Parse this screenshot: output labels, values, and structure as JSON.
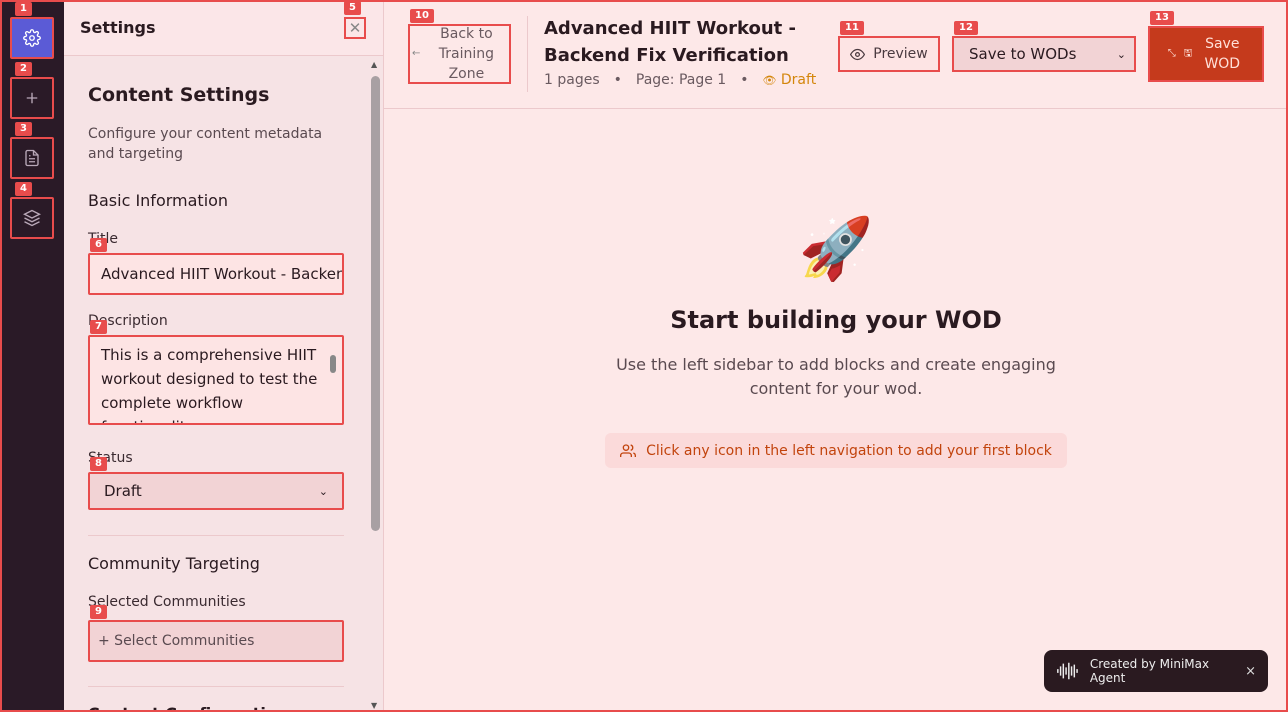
{
  "rail": {
    "items": [
      {
        "name": "settings",
        "marker": "1"
      },
      {
        "name": "add",
        "marker": "2"
      },
      {
        "name": "pages",
        "marker": "3"
      },
      {
        "name": "layers",
        "marker": "4"
      }
    ]
  },
  "panel": {
    "header_title": "Settings",
    "close_marker": "5",
    "section_title": "Content Settings",
    "section_desc": "Configure your content metadata and targeting",
    "basic_info_title": "Basic Information",
    "title_label": "Title",
    "title_value": "Advanced HIIT Workout - Backend Fix Verification",
    "title_marker": "6",
    "description_label": "Description",
    "description_value": "This is a comprehensive HIIT workout designed to test the complete workflow functionality",
    "description_marker": "7",
    "status_label": "Status",
    "status_value": "Draft",
    "status_marker": "8",
    "community_title": "Community Targeting",
    "communities_label": "Selected Communities",
    "communities_button": "+ Select Communities",
    "communities_marker": "9",
    "next_section_title": "Content Configuration"
  },
  "header": {
    "back_label": "Back to Training Zone",
    "back_marker": "10",
    "title": "Advanced HIIT Workout - Backend Fix Verification",
    "pages_count": "1 pages",
    "page_indicator": "Page: Page 1",
    "status": "Draft",
    "preview_label": "Preview",
    "preview_marker": "11",
    "save_select_value": "Save to WODs",
    "save_select_marker": "12",
    "save_button_label": "Save WOD",
    "save_button_marker": "13"
  },
  "canvas": {
    "emoji": "🚀",
    "heading": "Start building your WOD",
    "subtext": "Use the left sidebar to add blocks and create engaging content for your wod.",
    "hint": "Click any icon in the left navigation to add your first block"
  },
  "badge": {
    "label": "Created by MiniMax Agent",
    "close": "×"
  },
  "colors": {
    "accent": "#e84c4c",
    "rail_bg": "#2a1a27",
    "active": "#5b5bd6",
    "save": "#c53a1c",
    "draft": "#d4860b"
  }
}
